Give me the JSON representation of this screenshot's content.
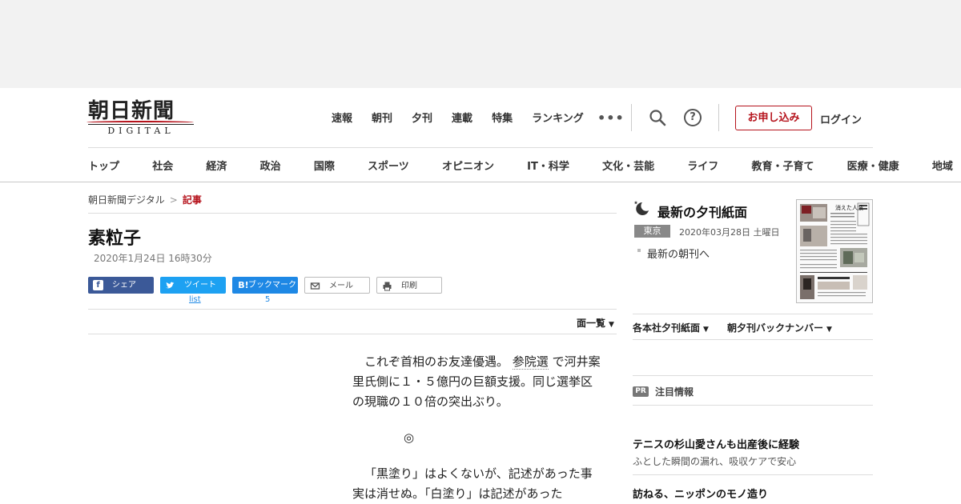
{
  "header": {
    "logo_title": "朝日新聞",
    "logo_sub": "DIGITAL",
    "top_nav": [
      "速報",
      "朝刊",
      "夕刊",
      "連載",
      "特集",
      "ランキング"
    ],
    "more_label": "•••",
    "help_label": "?",
    "apply_label": "お申し込み",
    "login_label": "ログイン",
    "accent_color": "#b5121b"
  },
  "category_nav": [
    "トップ",
    "社会",
    "経済",
    "政治",
    "国際",
    "スポーツ",
    "オピニオン",
    "IT・科学",
    "文化・芸能",
    "ライフ",
    "教育・子育て",
    "医療・健康",
    "地域"
  ],
  "breadcrumb": {
    "home": "朝日新聞デジタル",
    "separator": ">",
    "current": "記事"
  },
  "article": {
    "title": "素粒子",
    "date": "2020年1月24日 16時30分",
    "list_label": "面一覧",
    "paragraph1_a": "これぞ首相のお友達優遇。",
    "paragraph1_keyword": "参院選",
    "paragraph1_b": " で河井案里氏側に１・５億円の巨額支援。同じ選挙区の現職の１０倍の突出ぶり。",
    "mark": "◎",
    "paragraph2": "「黒塗り」はよくないが、記述があった事実は消せぬ。「白塗り」は記述があった"
  },
  "share": {
    "facebook": "シェア",
    "twitter": "ツイート",
    "hatena": "ブックマーク",
    "hatena_icon": "B!",
    "mail": "メール",
    "print": "印刷",
    "twitter_count": "list",
    "hatena_count": "5"
  },
  "sidebar": {
    "title": "最新の夕刊紙面",
    "location": "東京",
    "date": "2020年03月28日 土曜日",
    "morning_link": "最新の朝刊へ",
    "dropdown1": "各本社夕刊紙面",
    "dropdown2": "朝夕刊バックナンバー",
    "caret": "▼",
    "newspaper_headline": "消えた人波",
    "pr_badge": "PR",
    "pr_title": "注目情報",
    "pr_items": [
      {
        "title": "テニスの杉山愛さんも出産後に経験",
        "sub": "ふとした瞬間の漏れ、吸収ケアで安心"
      },
      {
        "title": "訪ねる、ニッポンのモノ造り"
      }
    ]
  }
}
